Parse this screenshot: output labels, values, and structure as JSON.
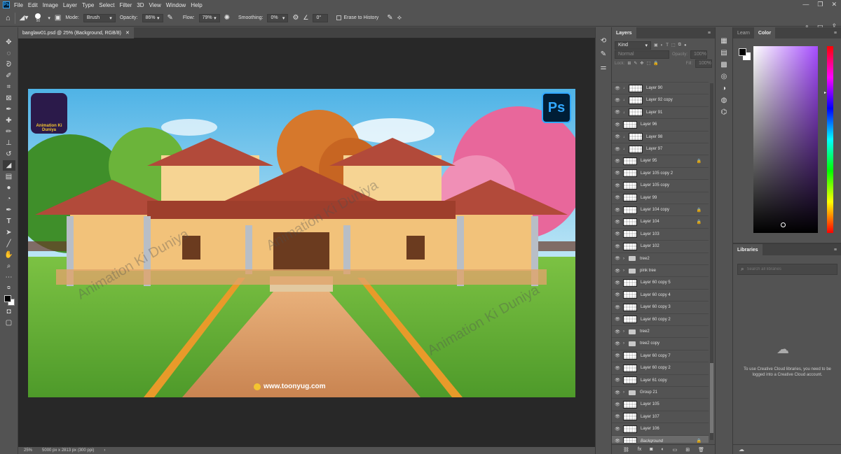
{
  "app": {
    "logo": "Ps"
  },
  "menu": [
    "File",
    "Edit",
    "Image",
    "Layer",
    "Type",
    "Select",
    "Filter",
    "3D",
    "View",
    "Window",
    "Help"
  ],
  "options": {
    "brush_size": "50",
    "mode_label": "Mode:",
    "mode_value": "Brush",
    "opacity_label": "Opacity:",
    "opacity_value": "86%",
    "flow_label": "Flow:",
    "flow_value": "79%",
    "smoothing_label": "Smoothing:",
    "smoothing_value": "0%",
    "angle_value": "0°",
    "erase_history": "Erase to History"
  },
  "document": {
    "tab_title": "banglaw01.psd @ 25% (Background, RGB/8)",
    "zoom": "25%",
    "doc_info": "5000 px x 2813 px (300 ppi)"
  },
  "canvas": {
    "watermark": "Animation Ki Duniya",
    "website": "www.toonyug.com",
    "logo_text": "Animation Ki Duniya",
    "ps_badge": "Ps"
  },
  "layers_panel": {
    "tab": "Layers",
    "filter_kind": "Kind",
    "blend_mode": "Normal",
    "opacity_label": "Opacity:",
    "opacity_value": "100%",
    "lock_label": "Lock:",
    "fill_label": "Fill:",
    "fill_value": "100%",
    "layers": [
      {
        "name": "Layer 90",
        "type": "layer",
        "indent": true,
        "locked": false
      },
      {
        "name": "Layer 92 copy",
        "type": "layer",
        "indent": true,
        "locked": false
      },
      {
        "name": "Layer 91",
        "type": "layer",
        "indent": true,
        "locked": false
      },
      {
        "name": "Layer 96",
        "type": "layer",
        "indent": false,
        "locked": false
      },
      {
        "name": "Layer 98",
        "type": "layer",
        "indent": true,
        "locked": false
      },
      {
        "name": "Layer 97",
        "type": "layer",
        "indent": true,
        "locked": false
      },
      {
        "name": "Layer 95",
        "type": "layer",
        "indent": false,
        "locked": true
      },
      {
        "name": "Layer 105 copy 2",
        "type": "layer",
        "indent": false,
        "locked": false
      },
      {
        "name": "Layer 105 copy",
        "type": "layer",
        "indent": false,
        "locked": false
      },
      {
        "name": "Layer 99",
        "type": "layer",
        "indent": false,
        "locked": false
      },
      {
        "name": "Layer 104 copy",
        "type": "layer",
        "indent": false,
        "locked": true
      },
      {
        "name": "Layer 104",
        "type": "layer",
        "indent": false,
        "locked": true
      },
      {
        "name": "Layer 103",
        "type": "layer",
        "indent": false,
        "locked": false
      },
      {
        "name": "Layer 102",
        "type": "layer",
        "indent": false,
        "locked": false
      },
      {
        "name": "tree2",
        "type": "group",
        "indent": false,
        "locked": false
      },
      {
        "name": "pink tree",
        "type": "group",
        "indent": false,
        "locked": false
      },
      {
        "name": "Layer 60 copy 5",
        "type": "layer",
        "indent": false,
        "locked": false
      },
      {
        "name": "Layer 60 copy 4",
        "type": "layer",
        "indent": false,
        "locked": false
      },
      {
        "name": "Layer 60 copy 3",
        "type": "layer",
        "indent": false,
        "locked": false
      },
      {
        "name": "Layer 60 copy 2",
        "type": "layer",
        "indent": false,
        "locked": false
      },
      {
        "name": "tree2",
        "type": "group",
        "indent": false,
        "locked": false
      },
      {
        "name": "tree2 copy",
        "type": "group",
        "indent": false,
        "locked": false
      },
      {
        "name": "Layer 60 copy 7",
        "type": "layer",
        "indent": false,
        "locked": false
      },
      {
        "name": "Layer 60 copy 2",
        "type": "layer",
        "indent": false,
        "locked": false
      },
      {
        "name": "Layer 61 copy",
        "type": "layer",
        "indent": false,
        "locked": false
      },
      {
        "name": "Group 21",
        "type": "group",
        "indent": false,
        "locked": false
      },
      {
        "name": "Layer 105",
        "type": "layer",
        "indent": false,
        "locked": false
      },
      {
        "name": "Layer 107",
        "type": "layer",
        "indent": false,
        "locked": false
      },
      {
        "name": "Layer 106",
        "type": "layer",
        "indent": false,
        "locked": false
      },
      {
        "name": "Background",
        "type": "layer",
        "indent": false,
        "locked": true,
        "selected": true
      }
    ]
  },
  "color_panel": {
    "tabs": [
      "Learn",
      "Color"
    ],
    "active": "Color"
  },
  "libraries_panel": {
    "tab": "Libraries",
    "search_placeholder": "Search all libraries",
    "message": "To use Creative Cloud libraries, you need to be logged into a Creative Cloud account."
  },
  "colors": {
    "accent": "#31a8ff",
    "sky": "#6fc3ea",
    "roof": "#b24a3a"
  }
}
